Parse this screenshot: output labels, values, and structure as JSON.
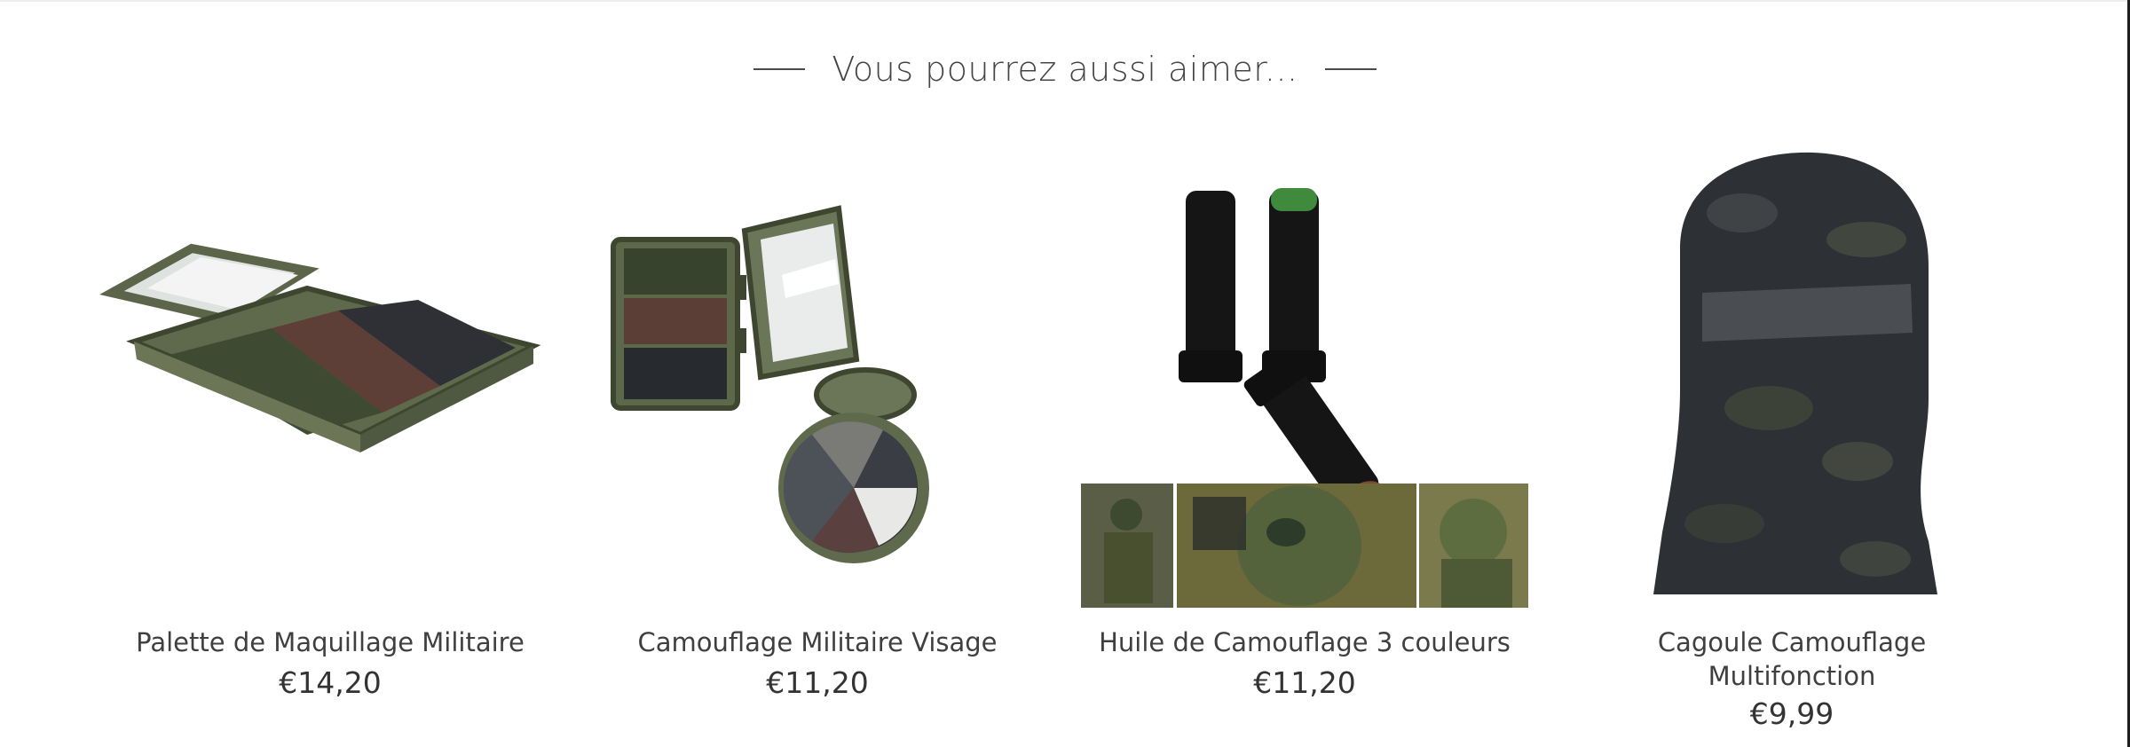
{
  "section": {
    "heading": "Vous pourrez aussi aimer..."
  },
  "products": [
    {
      "title": "Palette de Maquillage Militaire",
      "price": "€14,20",
      "image_icon": "camo-palette-image"
    },
    {
      "title": "Camouflage Militaire Visage",
      "price": "€11,20",
      "image_icon": "camo-compact-image"
    },
    {
      "title": "Huile de Camouflage 3 couleurs",
      "price": "€11,20",
      "image_icon": "camo-sticks-image"
    },
    {
      "title": "Cagoule Camouflage Multifonction",
      "price": "€9,99",
      "image_icon": "balaclava-image"
    }
  ],
  "colors": {
    "olive": "#4f5a3f",
    "brown": "#5e4038",
    "charcoal": "#2f3336",
    "case_green": "#6b7558"
  }
}
